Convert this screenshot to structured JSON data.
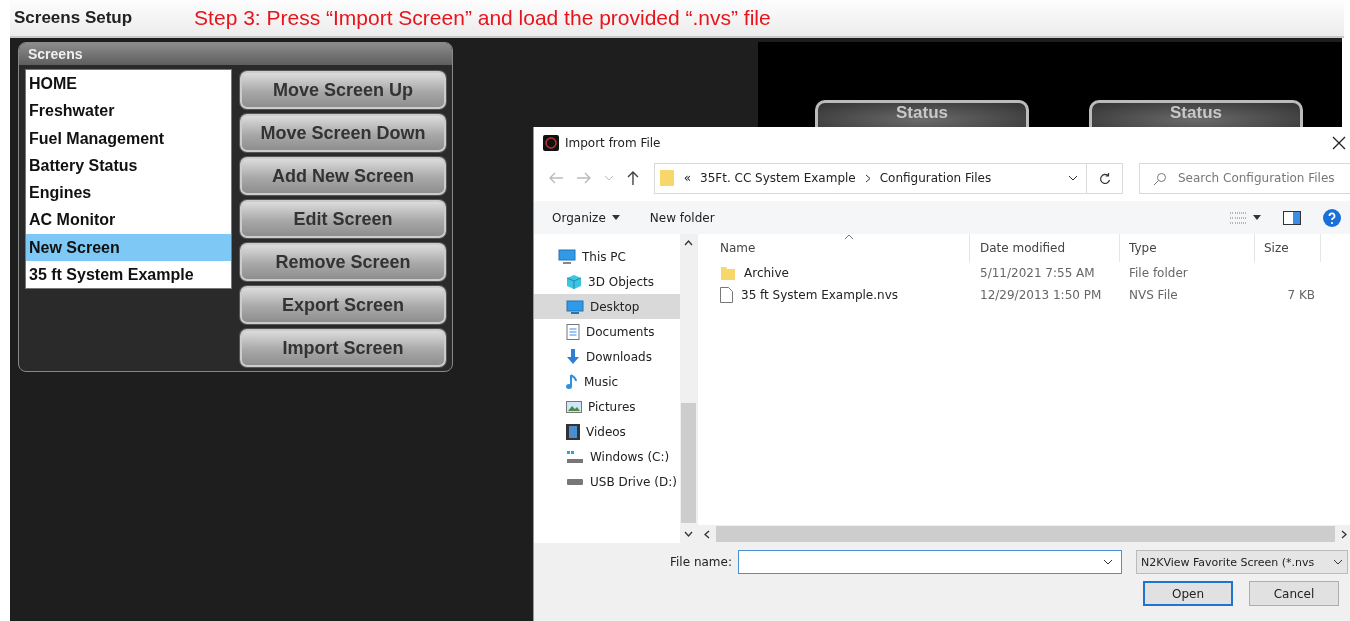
{
  "header": {
    "title": "Screens Setup",
    "instruction": "Step 3: Press “Import Screen” and load the provided “.nvs” file"
  },
  "screens_panel": {
    "title": "Screens",
    "items": [
      {
        "label": "HOME",
        "selected": false
      },
      {
        "label": "Freshwater",
        "selected": false
      },
      {
        "label": "Fuel Management",
        "selected": false
      },
      {
        "label": "Battery Status",
        "selected": false
      },
      {
        "label": "Engines",
        "selected": false
      },
      {
        "label": "AC Monitor",
        "selected": false
      },
      {
        "label": "New Screen",
        "selected": true
      },
      {
        "label": "35 ft System Example",
        "selected": false
      }
    ],
    "buttons": [
      "Move Screen Up",
      "Move Screen Down",
      "Add New Screen",
      "Edit Screen",
      "Remove Screen",
      "Export Screen",
      "Import Screen"
    ]
  },
  "preview": {
    "buttons": [
      "Status",
      "Status"
    ]
  },
  "dialog": {
    "title": "Import from File",
    "breadcrumb": [
      "«",
      "35Ft. CC System Example",
      "Configuration Files"
    ],
    "search": {
      "placeholder": "Search Configuration Files"
    },
    "toolbar": [
      "Organize",
      "New folder"
    ],
    "nav": [
      {
        "label": "This PC",
        "kind": "pc",
        "selected": false,
        "children": [
          {
            "label": "3D Objects",
            "kind": "cube",
            "selected": false
          },
          {
            "label": "Desktop",
            "kind": "desktop",
            "selected": true
          },
          {
            "label": "Documents",
            "kind": "doc",
            "selected": false
          },
          {
            "label": "Downloads",
            "kind": "download",
            "selected": false
          },
          {
            "label": "Music",
            "kind": "music",
            "selected": false
          },
          {
            "label": "Pictures",
            "kind": "pictures",
            "selected": false
          },
          {
            "label": "Videos",
            "kind": "videos",
            "selected": false
          },
          {
            "label": "Windows (C:)",
            "kind": "windrive",
            "selected": false
          },
          {
            "label": "USB Drive (D:)",
            "kind": "usbdrive",
            "selected": false
          }
        ]
      }
    ],
    "columns": [
      "Name",
      "Date modified",
      "Type",
      "Size"
    ],
    "files": [
      {
        "kind": "folder",
        "name": "Archive",
        "date": "5/11/2021 7:55 AM",
        "type": "File folder"
      },
      {
        "kind": "file",
        "name": "35 ft System Example.nvs",
        "date": "12/29/2013 1:50 PM",
        "type": "NVS File",
        "size": "7 KB"
      }
    ],
    "file_name_label": "File name:",
    "filter": "N2KView Favorite Screen (*.nvs",
    "buttons": [
      {
        "label": "Open",
        "default": true
      },
      {
        "label": "Cancel",
        "default": false
      }
    ]
  }
}
